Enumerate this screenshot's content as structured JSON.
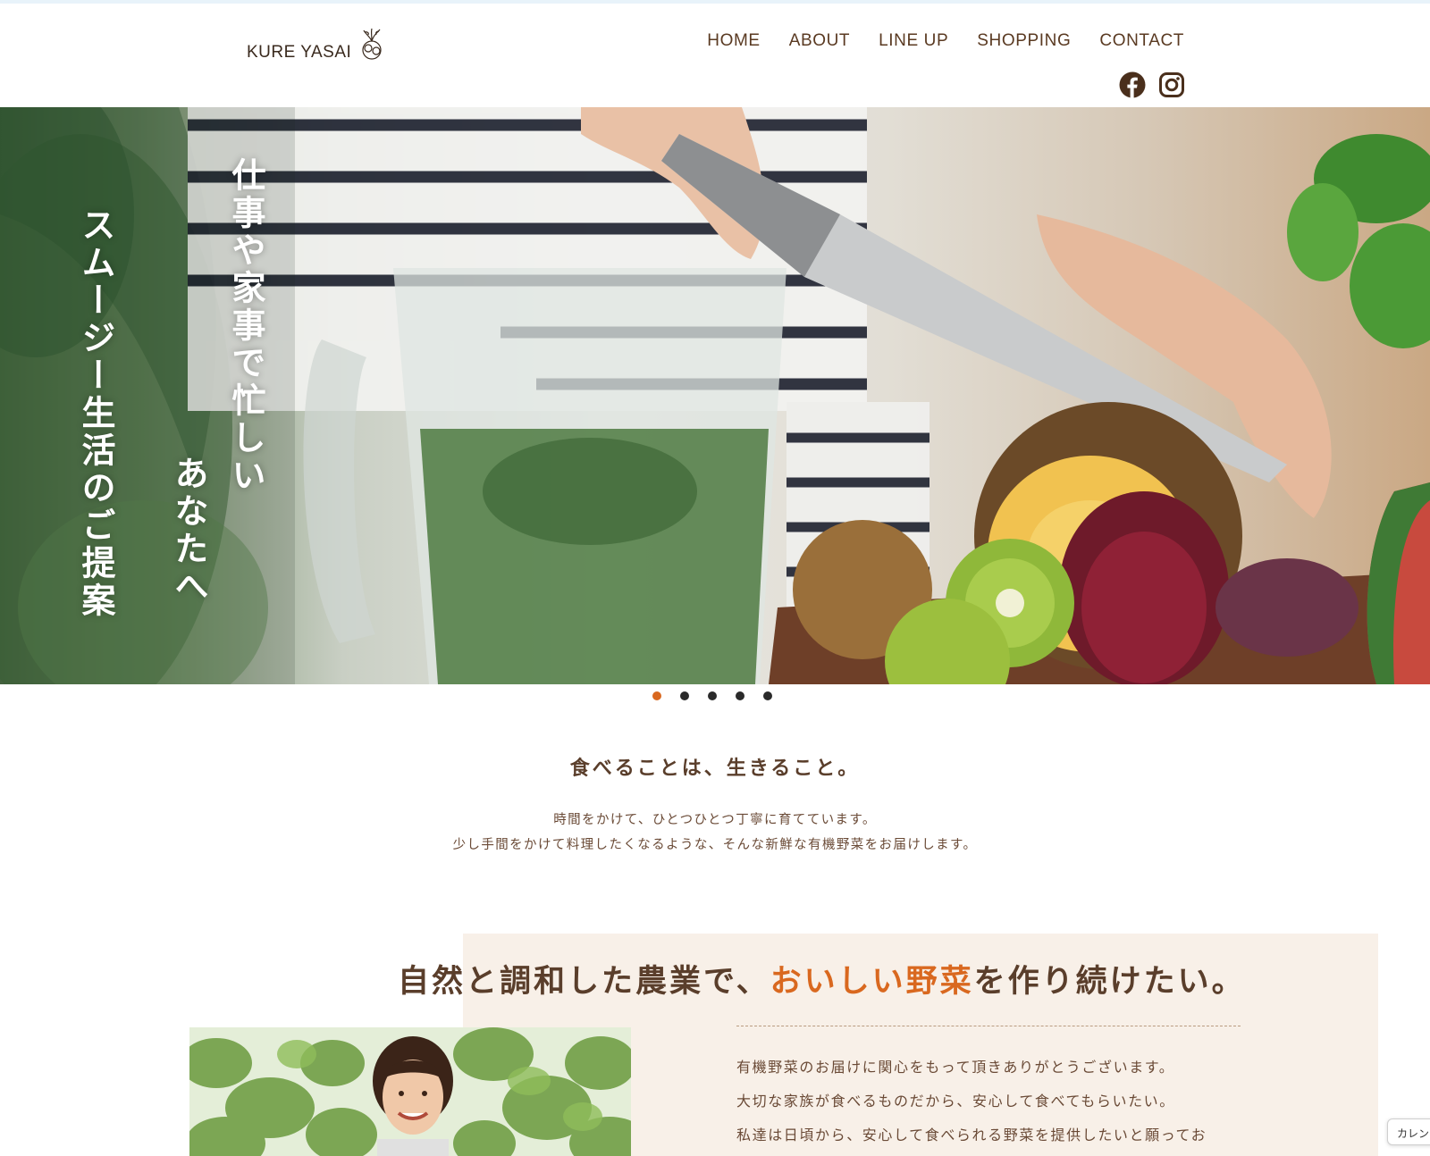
{
  "brand": {
    "name": "KURE YASAI",
    "logo_icon": "vegetable-sketch-icon"
  },
  "nav": {
    "items": [
      "HOME",
      "ABOUT",
      "LINE UP",
      "SHOPPING",
      "CONTACT"
    ]
  },
  "social": [
    {
      "icon": "facebook-icon"
    },
    {
      "icon": "instagram-icon"
    }
  ],
  "hero": {
    "lines": [
      "仕事や家事で忙しい",
      "あなたへ",
      "スムージー生活のご提案"
    ],
    "slides_total": 5,
    "active_slide": 1
  },
  "intro": {
    "title": "食べることは、生きること。",
    "body": [
      "時間をかけて、ひとつひとつ丁寧に育てています。",
      "少し手間をかけて料理したくなるような、そんな新鮮な有機野菜をお届けします。"
    ]
  },
  "feature": {
    "title_pre": "自然と調和した農業で、",
    "title_highlight": "おいしい野菜",
    "title_post": "を作り続けたい。",
    "body": [
      "有機野菜のお届けに関心をもって頂きありがとうございます。",
      "大切な家族が食べるものだから、安心して食べてもらいたい。",
      "私達は日頃から、安心して食べられる野菜を提供したいと願ってお"
    ]
  },
  "widget": {
    "label": "カレン"
  },
  "colors": {
    "accent": "#d9681f",
    "brown": "#5a3e2b",
    "beige": "#f8f0e8"
  }
}
